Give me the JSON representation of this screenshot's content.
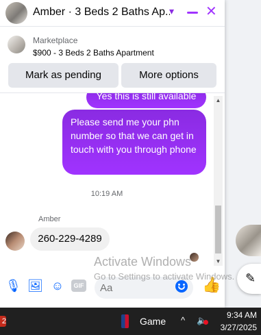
{
  "chat": {
    "title": "Amber · 3 Beds 2 Baths Ap...",
    "chevron_icon": "▾",
    "close_icon": "✕"
  },
  "listing": {
    "kicker": "Marketplace",
    "title": "$900 - 3 Beds 2 Baths Apartment",
    "mark_pending_label": "Mark as pending",
    "more_options_label": "More options"
  },
  "messages": {
    "outgoing_partial": "Yes this is still available",
    "outgoing_main": "Please send me your phn number so that we can get in touch with you through phone",
    "timestamp": "10:19 AM",
    "sender_name": "Amber",
    "incoming": "260-229-4289"
  },
  "composer": {
    "placeholder": "Aa",
    "gif_label": "GIF",
    "mic_icon": "🎙",
    "photo_icon": "🖼",
    "sticker_icon": "☺",
    "like_icon": "👍"
  },
  "watermark": {
    "title": "Activate Windows",
    "subtitle": "Go to Settings to activate Windows."
  },
  "sidebar": {
    "compose_icon": "✎"
  },
  "taskbar": {
    "badge": "2",
    "game_label": "Game",
    "chevron": "^",
    "speaker": "🔈",
    "time": "9:34 AM",
    "date": "3/27/2025"
  },
  "colors": {
    "accent": "#a033ff",
    "link": "#0866ff",
    "taskbar": "#202020"
  }
}
